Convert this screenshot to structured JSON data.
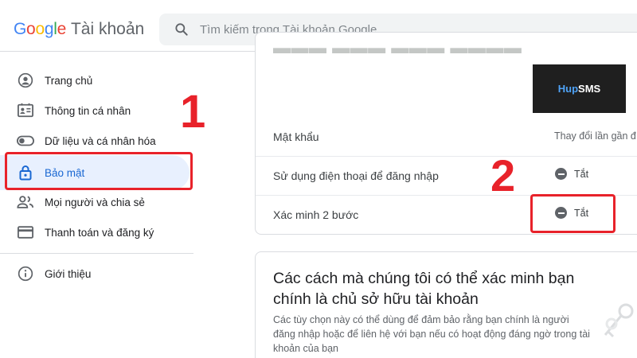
{
  "header": {
    "logo_google": "Google",
    "logo_product": "Tài khoản",
    "search_placeholder": "Tìm kiếm trong Tài khoản Google"
  },
  "sidebar": {
    "items": [
      {
        "label": "Trang chủ",
        "icon": "home-circle-icon"
      },
      {
        "label": "Thông tin cá nhân",
        "icon": "id-card-icon"
      },
      {
        "label": "Dữ liệu và cá nhân hóa",
        "icon": "toggle-icon"
      },
      {
        "label": "Bảo mật",
        "icon": "lock-icon",
        "active": true
      },
      {
        "label": "Mọi người và chia sẻ",
        "icon": "people-icon"
      },
      {
        "label": "Thanh toán và đăng ký",
        "icon": "credit-card-icon"
      },
      {
        "label": "Giới thiệu",
        "icon": "info-icon"
      }
    ]
  },
  "annotations": {
    "num1": "1",
    "num2": "2",
    "color": "#e8222a"
  },
  "card1": {
    "brand_part1": "Hup",
    "brand_part2": "SMS",
    "rows": [
      {
        "label": "Mật khẩu",
        "value": "Thay đổi lần gần đ"
      },
      {
        "label": "Sử dụng điện thoại để đăng nhập",
        "status": "Tắt"
      },
      {
        "label": "Xác minh 2 bước",
        "status": "Tắt"
      }
    ]
  },
  "card2": {
    "title": "Các cách mà chúng tôi có thể xác minh bạn chính là chủ sở hữu tài khoản",
    "description": "Các tùy chọn này có thể dùng để đảm bảo rằng bạn chính là người đăng nhập hoặc để liên hệ với bạn nếu có hoạt động đáng ngờ trong tài khoản của bạn"
  },
  "colors": {
    "accent_blue": "#1967d2",
    "active_bg": "#e8f0fe"
  }
}
